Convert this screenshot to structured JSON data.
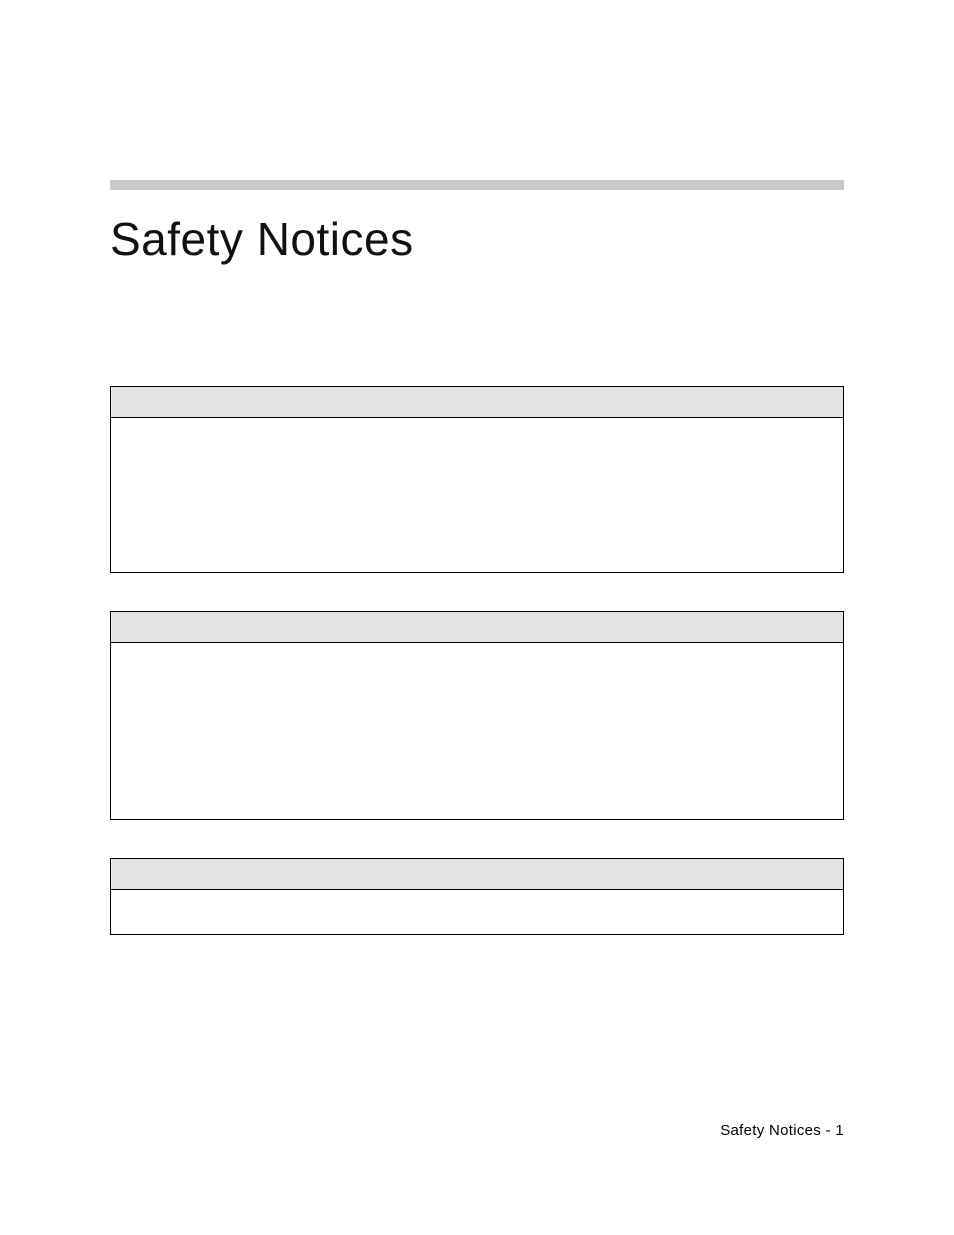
{
  "title": "Safety Notices",
  "notices": [
    {
      "heading": "",
      "body": ""
    },
    {
      "heading": "",
      "body": ""
    },
    {
      "heading": "",
      "body": ""
    }
  ],
  "footer": {
    "section": "Safety Notices",
    "separator": " - ",
    "page": "1"
  }
}
